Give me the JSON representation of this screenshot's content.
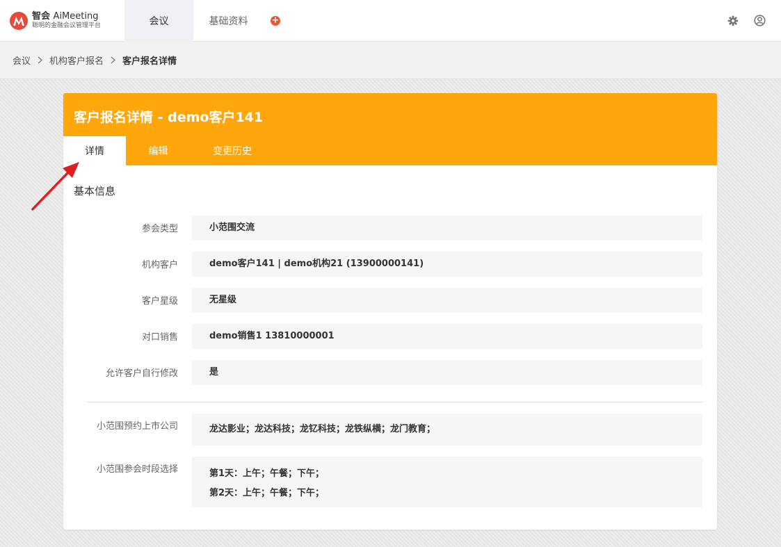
{
  "app": {
    "logo_title": "智会",
    "logo_brand": "AiMeeting",
    "logo_subtitle": "聪明的金融会议管理平台",
    "logo_mark_text": "M"
  },
  "topnav": {
    "tabs": [
      {
        "label": "会议",
        "active": true
      },
      {
        "label": "基础资料",
        "active": false
      }
    ],
    "add_icon": "+"
  },
  "breadcrumb": {
    "items": [
      "会议",
      "机构客户报名",
      "客户报名详情"
    ]
  },
  "card": {
    "title": "客户报名详情 - demo客户141",
    "tabs": [
      {
        "label": "详情",
        "active": true
      },
      {
        "label": "编辑",
        "active": false
      },
      {
        "label": "变更历史",
        "active": false
      }
    ],
    "section_title": "基本信息",
    "fields": [
      {
        "label": "参会类型",
        "value": "小范围交流"
      },
      {
        "label": "机构客户",
        "value": "demo客户141 | demo机构21 (13900000141)"
      },
      {
        "label": "客户星级",
        "value": "无星级"
      },
      {
        "label": "对口销售",
        "value": "demo销售1 13810000001"
      },
      {
        "label": "允许客户自行修改",
        "value": "是"
      }
    ],
    "extra_fields": [
      {
        "label": "小范围预约上市公司",
        "lines": [
          "龙达影业；龙达科技；龙钇科技；龙铁纵横；龙门教育；"
        ]
      },
      {
        "label": "小范围参会时段选择",
        "lines": [
          "第1天：上午；午餐；下午；",
          "第2天：上午；午餐；下午；"
        ]
      }
    ]
  },
  "colors": {
    "accent": "#ffa60a",
    "logo": "#e8493b",
    "add": "#f0532e",
    "annotation_arrow": "#e02020"
  },
  "icons": {
    "settings": "gear-icon",
    "user": "user-icon",
    "breadcrumb_separator": "chevron-right-icon",
    "annotation": "red-arrow-icon"
  }
}
